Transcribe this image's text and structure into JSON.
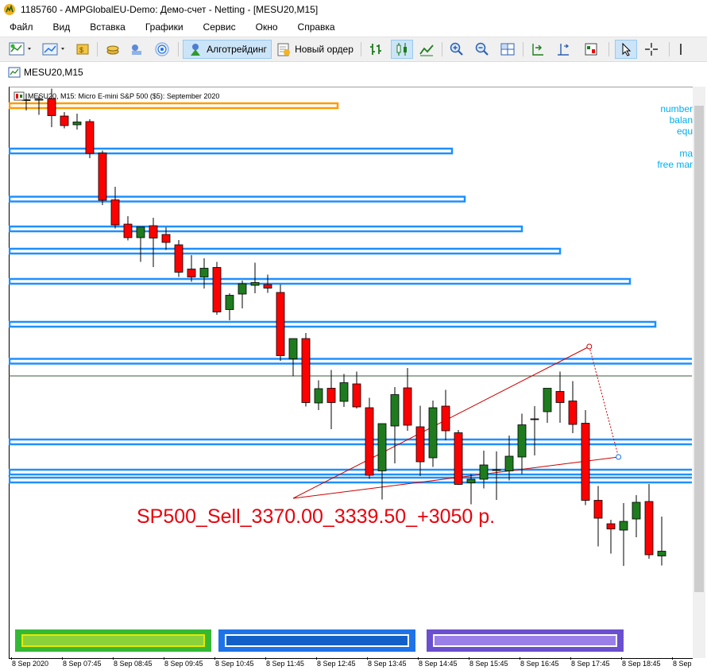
{
  "window": {
    "title": "1185760 - AMPGlobalEU-Demo: Демо-счет - Netting - [MESU20,M15]"
  },
  "menu": {
    "items": [
      "Файл",
      "Вид",
      "Вставка",
      "Графики",
      "Сервис",
      "Окно",
      "Справка"
    ]
  },
  "toolbar": {
    "algotrading_label": "Алготрейдинг",
    "new_order_label": "Новый ордер"
  },
  "chart_tab": {
    "title": "MESU20,M15"
  },
  "chart": {
    "symbol_line": "MESU20, M15:  Micro E-mini S&P 500 ($5): September 2020",
    "info_lines": [
      "number",
      "balan",
      "equ",
      "",
      "ma",
      "free mar"
    ],
    "trade_label": "SP500_Sell_3370.00_3339.50_+3050 р.",
    "colors": {
      "bull": "#1e7c1e",
      "bear": "#ff0000",
      "level_box": "#1e90ff",
      "orange_box": "#ff9900",
      "trendline": "#cc0000",
      "info_text": "#00aeef"
    }
  },
  "chart_data": {
    "type": "candlestick",
    "candles": [
      {
        "o": 3.0,
        "h": 11.5,
        "l": -10.0,
        "c": 3.5
      },
      {
        "o": 4.0,
        "h": 8.5,
        "l": -15.5,
        "c": 4.0
      },
      {
        "o": 5.0,
        "h": 17.5,
        "l": -31.0,
        "c": -16.5
      },
      {
        "o": -17.0,
        "h": -12.0,
        "l": -32.5,
        "c": -29.0
      },
      {
        "o": -28.0,
        "h": -14.0,
        "l": -34.0,
        "c": -24.5
      },
      {
        "o": -24.0,
        "h": -21.0,
        "l": -70.0,
        "c": -64.0
      },
      {
        "o": -63.5,
        "h": -60.5,
        "l": -129.0,
        "c": -123.0
      },
      {
        "o": -122.5,
        "h": -106.0,
        "l": -158.5,
        "c": -154.0
      },
      {
        "o": -153.0,
        "h": -143.0,
        "l": -173.5,
        "c": -170.0
      },
      {
        "o": -170.0,
        "h": -159.0,
        "l": -200.5,
        "c": -156.5
      },
      {
        "o": -155.0,
        "h": -145.0,
        "l": -207.0,
        "c": -170.5
      },
      {
        "o": -166.0,
        "h": -157.0,
        "l": -185.5,
        "c": -176.0
      },
      {
        "o": -179.0,
        "h": -173.0,
        "l": -219.5,
        "c": -213.5
      },
      {
        "o": -209.5,
        "h": -192.0,
        "l": -225.5,
        "c": -219.5
      },
      {
        "o": -219.5,
        "h": -196.0,
        "l": -234.0,
        "c": -208.5
      },
      {
        "o": -207.5,
        "h": -200.5,
        "l": -267.0,
        "c": -263.5
      },
      {
        "o": -260.5,
        "h": -240.0,
        "l": -274.0,
        "c": -242.5
      },
      {
        "o": -241.0,
        "h": -224.0,
        "l": -259.0,
        "c": -228.0
      },
      {
        "o": -230.0,
        "h": -201.5,
        "l": -240.0,
        "c": -226.5
      },
      {
        "o": -229.0,
        "h": -216.5,
        "l": -239.5,
        "c": -233.5
      },
      {
        "o": -239.0,
        "h": -229.0,
        "l": -325.0,
        "c": -318.5
      },
      {
        "o": -322.5,
        "h": -299.5,
        "l": -344.5,
        "c": -297.0
      },
      {
        "o": -297.0,
        "h": -290.0,
        "l": -382.5,
        "c": -377.5
      },
      {
        "o": -378.0,
        "h": -349.5,
        "l": -387.0,
        "c": -360.0
      },
      {
        "o": -359.5,
        "h": -336.5,
        "l": -411.0,
        "c": -377.5
      },
      {
        "o": -376.0,
        "h": -341.5,
        "l": -383.0,
        "c": -352.5
      },
      {
        "o": -354.0,
        "h": -338.5,
        "l": -385.0,
        "c": -383.0
      },
      {
        "o": -384.0,
        "h": -371.5,
        "l": -473.5,
        "c": -469.0
      },
      {
        "o": -463.5,
        "h": -409.0,
        "l": -499.5,
        "c": -404.0
      },
      {
        "o": -407.0,
        "h": -358.0,
        "l": -454.0,
        "c": -367.5
      },
      {
        "o": -359.0,
        "h": -334.0,
        "l": -413.0,
        "c": -406.0
      },
      {
        "o": -408.0,
        "h": -381.5,
        "l": -470.0,
        "c": -452.0
      },
      {
        "o": -447.0,
        "h": -375.0,
        "l": -458.5,
        "c": -384.0
      },
      {
        "o": -382.0,
        "h": -361.5,
        "l": -425.0,
        "c": -413.0
      },
      {
        "o": -415.5,
        "h": -412.0,
        "l": -481.0,
        "c": -480.5
      },
      {
        "o": -478.5,
        "h": -467.5,
        "l": -505.5,
        "c": -474.0
      },
      {
        "o": -474.0,
        "h": -438.0,
        "l": -485.5,
        "c": -456.0
      },
      {
        "o": -462.0,
        "h": -439.0,
        "l": -500.0,
        "c": -462.0
      },
      {
        "o": -463.5,
        "h": -419.0,
        "l": -475.5,
        "c": -445.0
      },
      {
        "o": -446.0,
        "h": -391.5,
        "l": -467.5,
        "c": -405.5
      },
      {
        "o": -398.0,
        "h": -382.0,
        "l": -444.0,
        "c": -398.5
      },
      {
        "o": -389.0,
        "h": -361.0,
        "l": -403.0,
        "c": -359.5
      },
      {
        "o": -363.5,
        "h": -338.5,
        "l": -403.0,
        "c": -377.5
      },
      {
        "o": -375.5,
        "h": -350.5,
        "l": -416.0,
        "c": -405.0
      },
      {
        "o": -403.5,
        "h": -387.0,
        "l": -506.5,
        "c": -500.5
      },
      {
        "o": -500.5,
        "h": -482.5,
        "l": -558.5,
        "c": -523.0
      },
      {
        "o": -530.0,
        "h": -525.0,
        "l": -567.5,
        "c": -536.5
      },
      {
        "o": -538.0,
        "h": -504.0,
        "l": -583.0,
        "c": -527.0
      },
      {
        "o": -524.0,
        "h": -494.0,
        "l": -547.0,
        "c": -503.0
      },
      {
        "o": -502.0,
        "h": -480.0,
        "l": -574.0,
        "c": -569.0
      },
      {
        "o": -570.5,
        "h": -521.0,
        "l": -582.5,
        "c": -564.5
      }
    ],
    "levels": [
      {
        "y1": -7.0,
        "y2": -1.0,
        "x_end": 24.5,
        "color": "orange"
      },
      {
        "y1": -64.0,
        "y2": -58.0,
        "x_end": 33.5,
        "color": "blue"
      },
      {
        "y1": -124.5,
        "y2": -118.5,
        "x_end": 34.5,
        "color": "blue"
      },
      {
        "y1": -162.0,
        "y2": -156.0,
        "x_end": 39.0,
        "color": "blue"
      },
      {
        "y1": -190.0,
        "y2": -184.0,
        "x_end": 42.0,
        "color": "blue"
      },
      {
        "y1": -228.0,
        "y2": -222.0,
        "x_end": 47.5,
        "color": "blue"
      },
      {
        "y1": -282.0,
        "y2": -276.0,
        "x_end": 49.5,
        "color": "blue"
      },
      {
        "y1": -328.5,
        "y2": -322.5,
        "x_end": 56.0,
        "color": "blue"
      },
      {
        "y1": -430.0,
        "y2": -424.0,
        "x_end": 56.0,
        "color": "blue"
      },
      {
        "y1": -468.0,
        "y2": -462.0,
        "x_end": 56.0,
        "color": "blue"
      },
      {
        "y1": -478.0,
        "y2": -472.0,
        "x_end": 56.0,
        "color": "blue"
      }
    ],
    "time_labels": [
      "8 Sep 2020",
      "8 Sep 07:45",
      "8 Sep 08:45",
      "8 Sep 09:45",
      "8 Sep 10:45",
      "8 Sep 11:45",
      "8 Sep 12:45",
      "8 Sep 13:45",
      "8 Sep 14:45",
      "8 Sep 15:45",
      "8 Sep 16:45",
      "8 Sep 17:45",
      "8 Sep 18:45",
      "8 Sep"
    ],
    "current_price_line": -344.0
  },
  "bottom_buttons": [
    {
      "color": "#34b934",
      "inner": "#8bd13a"
    },
    {
      "color": "#1e73e8",
      "inner": "#1260c7"
    },
    {
      "color": "#6a4fcf",
      "inner": "#9a7fe8"
    }
  ],
  "icons": {
    "app": "metatrader-icon",
    "chart_tab": "chart-window-icon"
  }
}
